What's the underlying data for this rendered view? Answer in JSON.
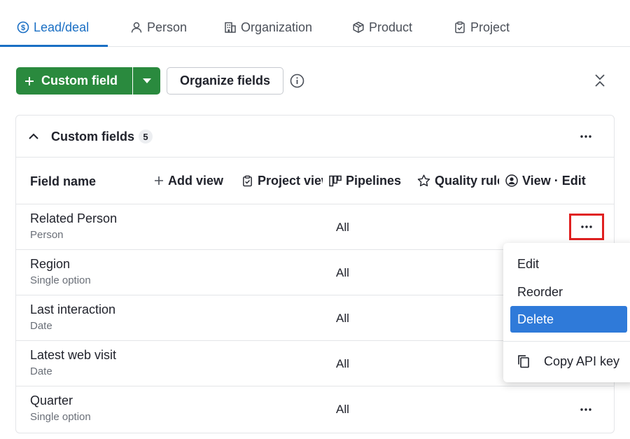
{
  "tabs": [
    {
      "label": "Lead/deal",
      "icon": "dollar-circle-icon"
    },
    {
      "label": "Person",
      "icon": "person-icon"
    },
    {
      "label": "Organization",
      "icon": "building-icon"
    },
    {
      "label": "Product",
      "icon": "box-icon"
    },
    {
      "label": "Project",
      "icon": "clipboard-check-icon"
    }
  ],
  "toolbar": {
    "custom_field_label": "Custom field",
    "organize_fields_label": "Organize fields"
  },
  "panel": {
    "title": "Custom fields",
    "count": "5"
  },
  "columns": {
    "field_name": "Field name",
    "add_view": "Add view",
    "project_view": "Project view",
    "pipelines": "Pipelines",
    "quality_rules": "Quality rules",
    "view_edit": "View · Edit"
  },
  "rows": [
    {
      "name": "Related Person",
      "type": "Person",
      "pipelines": "All"
    },
    {
      "name": "Region",
      "type": "Single option",
      "pipelines": "All"
    },
    {
      "name": "Last interaction",
      "type": "Date",
      "pipelines": "All"
    },
    {
      "name": "Latest web visit",
      "type": "Date",
      "pipelines": "All"
    },
    {
      "name": "Quarter",
      "type": "Single option",
      "pipelines": "All"
    }
  ],
  "menu": {
    "edit": "Edit",
    "reorder": "Reorder",
    "delete": "Delete",
    "copy_api_key": "Copy API key"
  },
  "colors": {
    "accent": "#1a6fc4",
    "primary_button": "#2a8a3e",
    "menu_selected": "#2f7ad9",
    "highlight_box": "#e02020"
  }
}
